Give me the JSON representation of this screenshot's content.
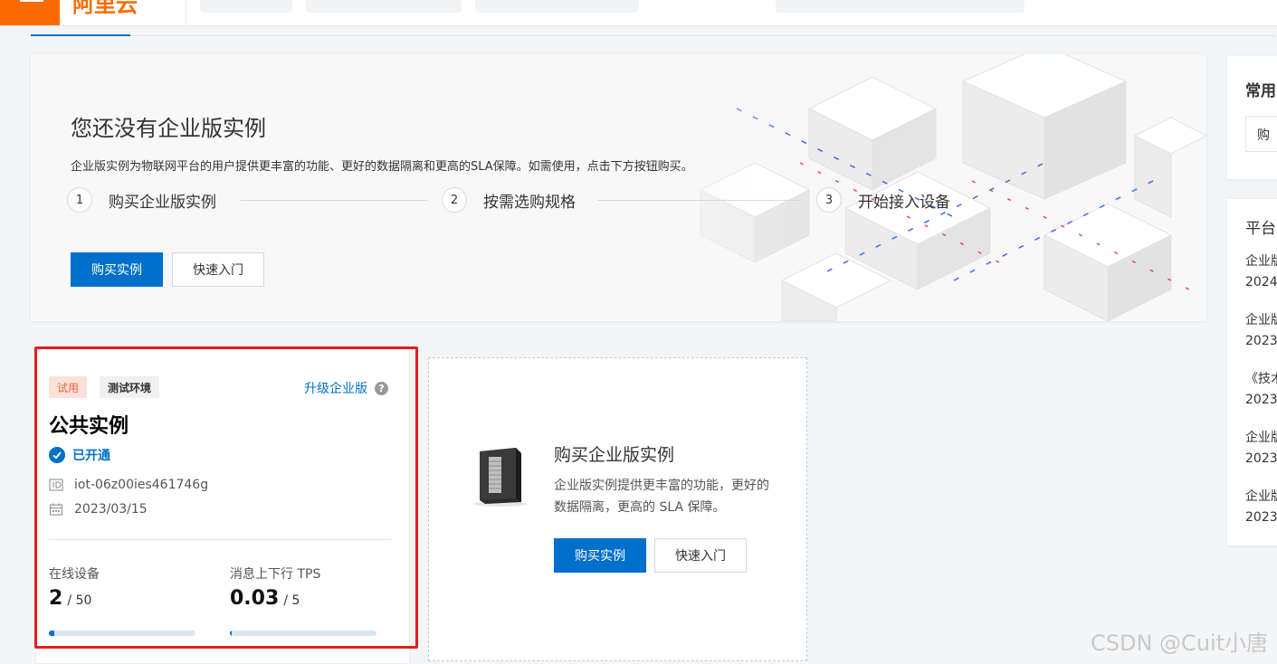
{
  "topbar": {
    "logo_text": "阿里云"
  },
  "hero": {
    "title": "您还没有企业版实例",
    "description": "企业版实例为物联网平台的用户提供更丰富的功能、更好的数据隔离和更高的SLA保障。如需使用，点击下方按钮购买。",
    "steps": [
      {
        "num": "1",
        "label": "购买企业版实例"
      },
      {
        "num": "2",
        "label": "按需选购规格"
      },
      {
        "num": "3",
        "label": "开始接入设备"
      }
    ],
    "buy_button": "购买实例",
    "quickstart_button": "快速入门"
  },
  "side": {
    "common_title": "常用",
    "common_item": "购",
    "platform_title": "平台",
    "items": [
      {
        "title": "企业版",
        "date": "2024"
      },
      {
        "title": "企业版",
        "date": "2023"
      },
      {
        "title": "《技术",
        "date": "2023"
      },
      {
        "title": "企业版",
        "date": "2023"
      },
      {
        "title": "企业版",
        "date": "2023"
      }
    ]
  },
  "instance_card": {
    "tag_trial": "试用",
    "tag_env": "测试环境",
    "upgrade_link": "升级企业版",
    "help": "?",
    "title": "公共实例",
    "status": "已开通",
    "instance_id": "iot-06z00ies461746g",
    "date": "2023/03/15",
    "metrics": [
      {
        "label": "在线设备",
        "value": "2",
        "total": "/ 50",
        "fraction": 0.04
      },
      {
        "label": "消息上下行 TPS",
        "value": "0.03",
        "total": "/ 5",
        "fraction": 0.006
      }
    ]
  },
  "buy_card": {
    "title": "购买企业版实例",
    "description": "企业版实例提供更丰富的功能，更好的数据隔离，更高的 SLA 保障。",
    "buy_button": "购买实例",
    "quickstart_button": "快速入门"
  },
  "watermark": "CSDN @Cuit小唐",
  "colors": {
    "brand": "#ff6a00",
    "primary": "#0070cc",
    "highlight": "#e02020"
  }
}
